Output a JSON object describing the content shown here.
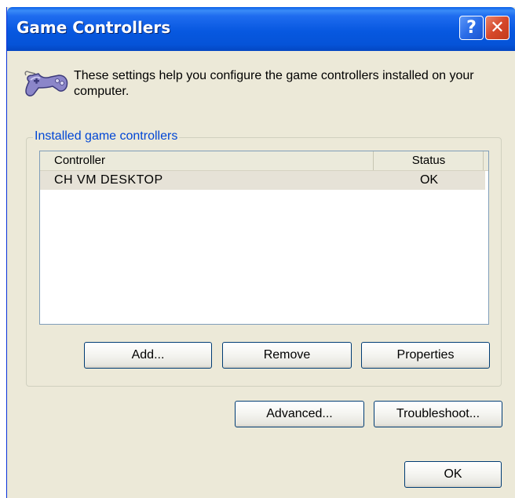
{
  "window": {
    "title": "Game Controllers",
    "help_label": "?",
    "close_label": "✕"
  },
  "intro": {
    "icon": "gamepad-icon",
    "text": "These settings help you configure the game controllers installed on your computer."
  },
  "group": {
    "legend": "Installed game controllers",
    "columns": {
      "controller": "Controller",
      "status": "Status"
    },
    "rows": [
      {
        "controller": "CH VM DESKTOP",
        "status": "OK"
      }
    ],
    "buttons": {
      "add": "Add...",
      "remove": "Remove",
      "properties": "Properties"
    }
  },
  "footer": {
    "advanced": "Advanced...",
    "troubleshoot": "Troubleshoot...",
    "ok": "OK"
  },
  "colors": {
    "titlebar": "#0553d8",
    "face": "#ece9d8",
    "group_legend": "#0046d5",
    "selected_row": "#e6e2d7",
    "close_button": "#d6482a"
  }
}
